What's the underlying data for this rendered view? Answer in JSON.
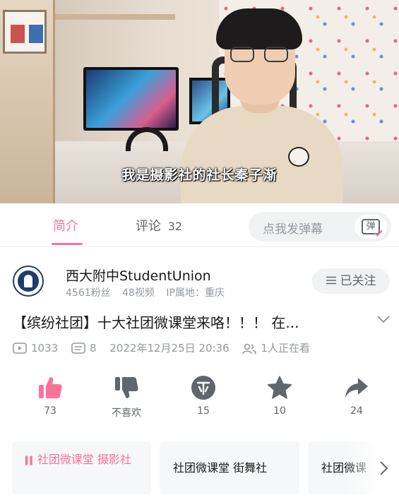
{
  "video": {
    "subtitle": "我是摄影社的社长秦子渐"
  },
  "tabs": [
    {
      "label": "简介",
      "active": true
    },
    {
      "label": "评论",
      "count": "32"
    }
  ],
  "danmaku": {
    "placeholder": "点我发弹幕",
    "button_glyph": "弹"
  },
  "channel": {
    "name": "西大附中StudentUnion",
    "fans": "4561粉丝",
    "videos": "48视频",
    "ip_location": "IP属地：重庆",
    "follow_label": "已关注",
    "follow_icon": "menu-icon"
  },
  "video_info": {
    "title": "【缤纷社团】十大社团微课堂来咯！！！ 在...",
    "plays": "1033",
    "danmaku_count": "8",
    "publish_time": "2022年12月25日 20:36",
    "watching": "1人正在看"
  },
  "actions": [
    {
      "name": "like",
      "icon": "thumbs-up-icon",
      "label": "73",
      "color": "#fb7299"
    },
    {
      "name": "dislike",
      "icon": "thumbs-down-icon",
      "label": "不喜欢",
      "color": "#61666d"
    },
    {
      "name": "coin",
      "icon": "coin-icon",
      "label": "15",
      "color": "#61666d"
    },
    {
      "name": "favorite",
      "icon": "star-icon",
      "label": "10",
      "color": "#61666d"
    },
    {
      "name": "share",
      "icon": "share-icon",
      "label": "24",
      "color": "#61666d"
    }
  ],
  "tags": [
    {
      "prefix": "▍▍",
      "label": "社团微课堂 摄影社"
    },
    {
      "label": "社团微课堂 街舞社"
    },
    {
      "label": "社团微课"
    }
  ],
  "colors": {
    "accent": "#fb7299",
    "text_primary": "#18191c",
    "text_secondary": "#61666d",
    "text_muted": "#9499a0"
  }
}
